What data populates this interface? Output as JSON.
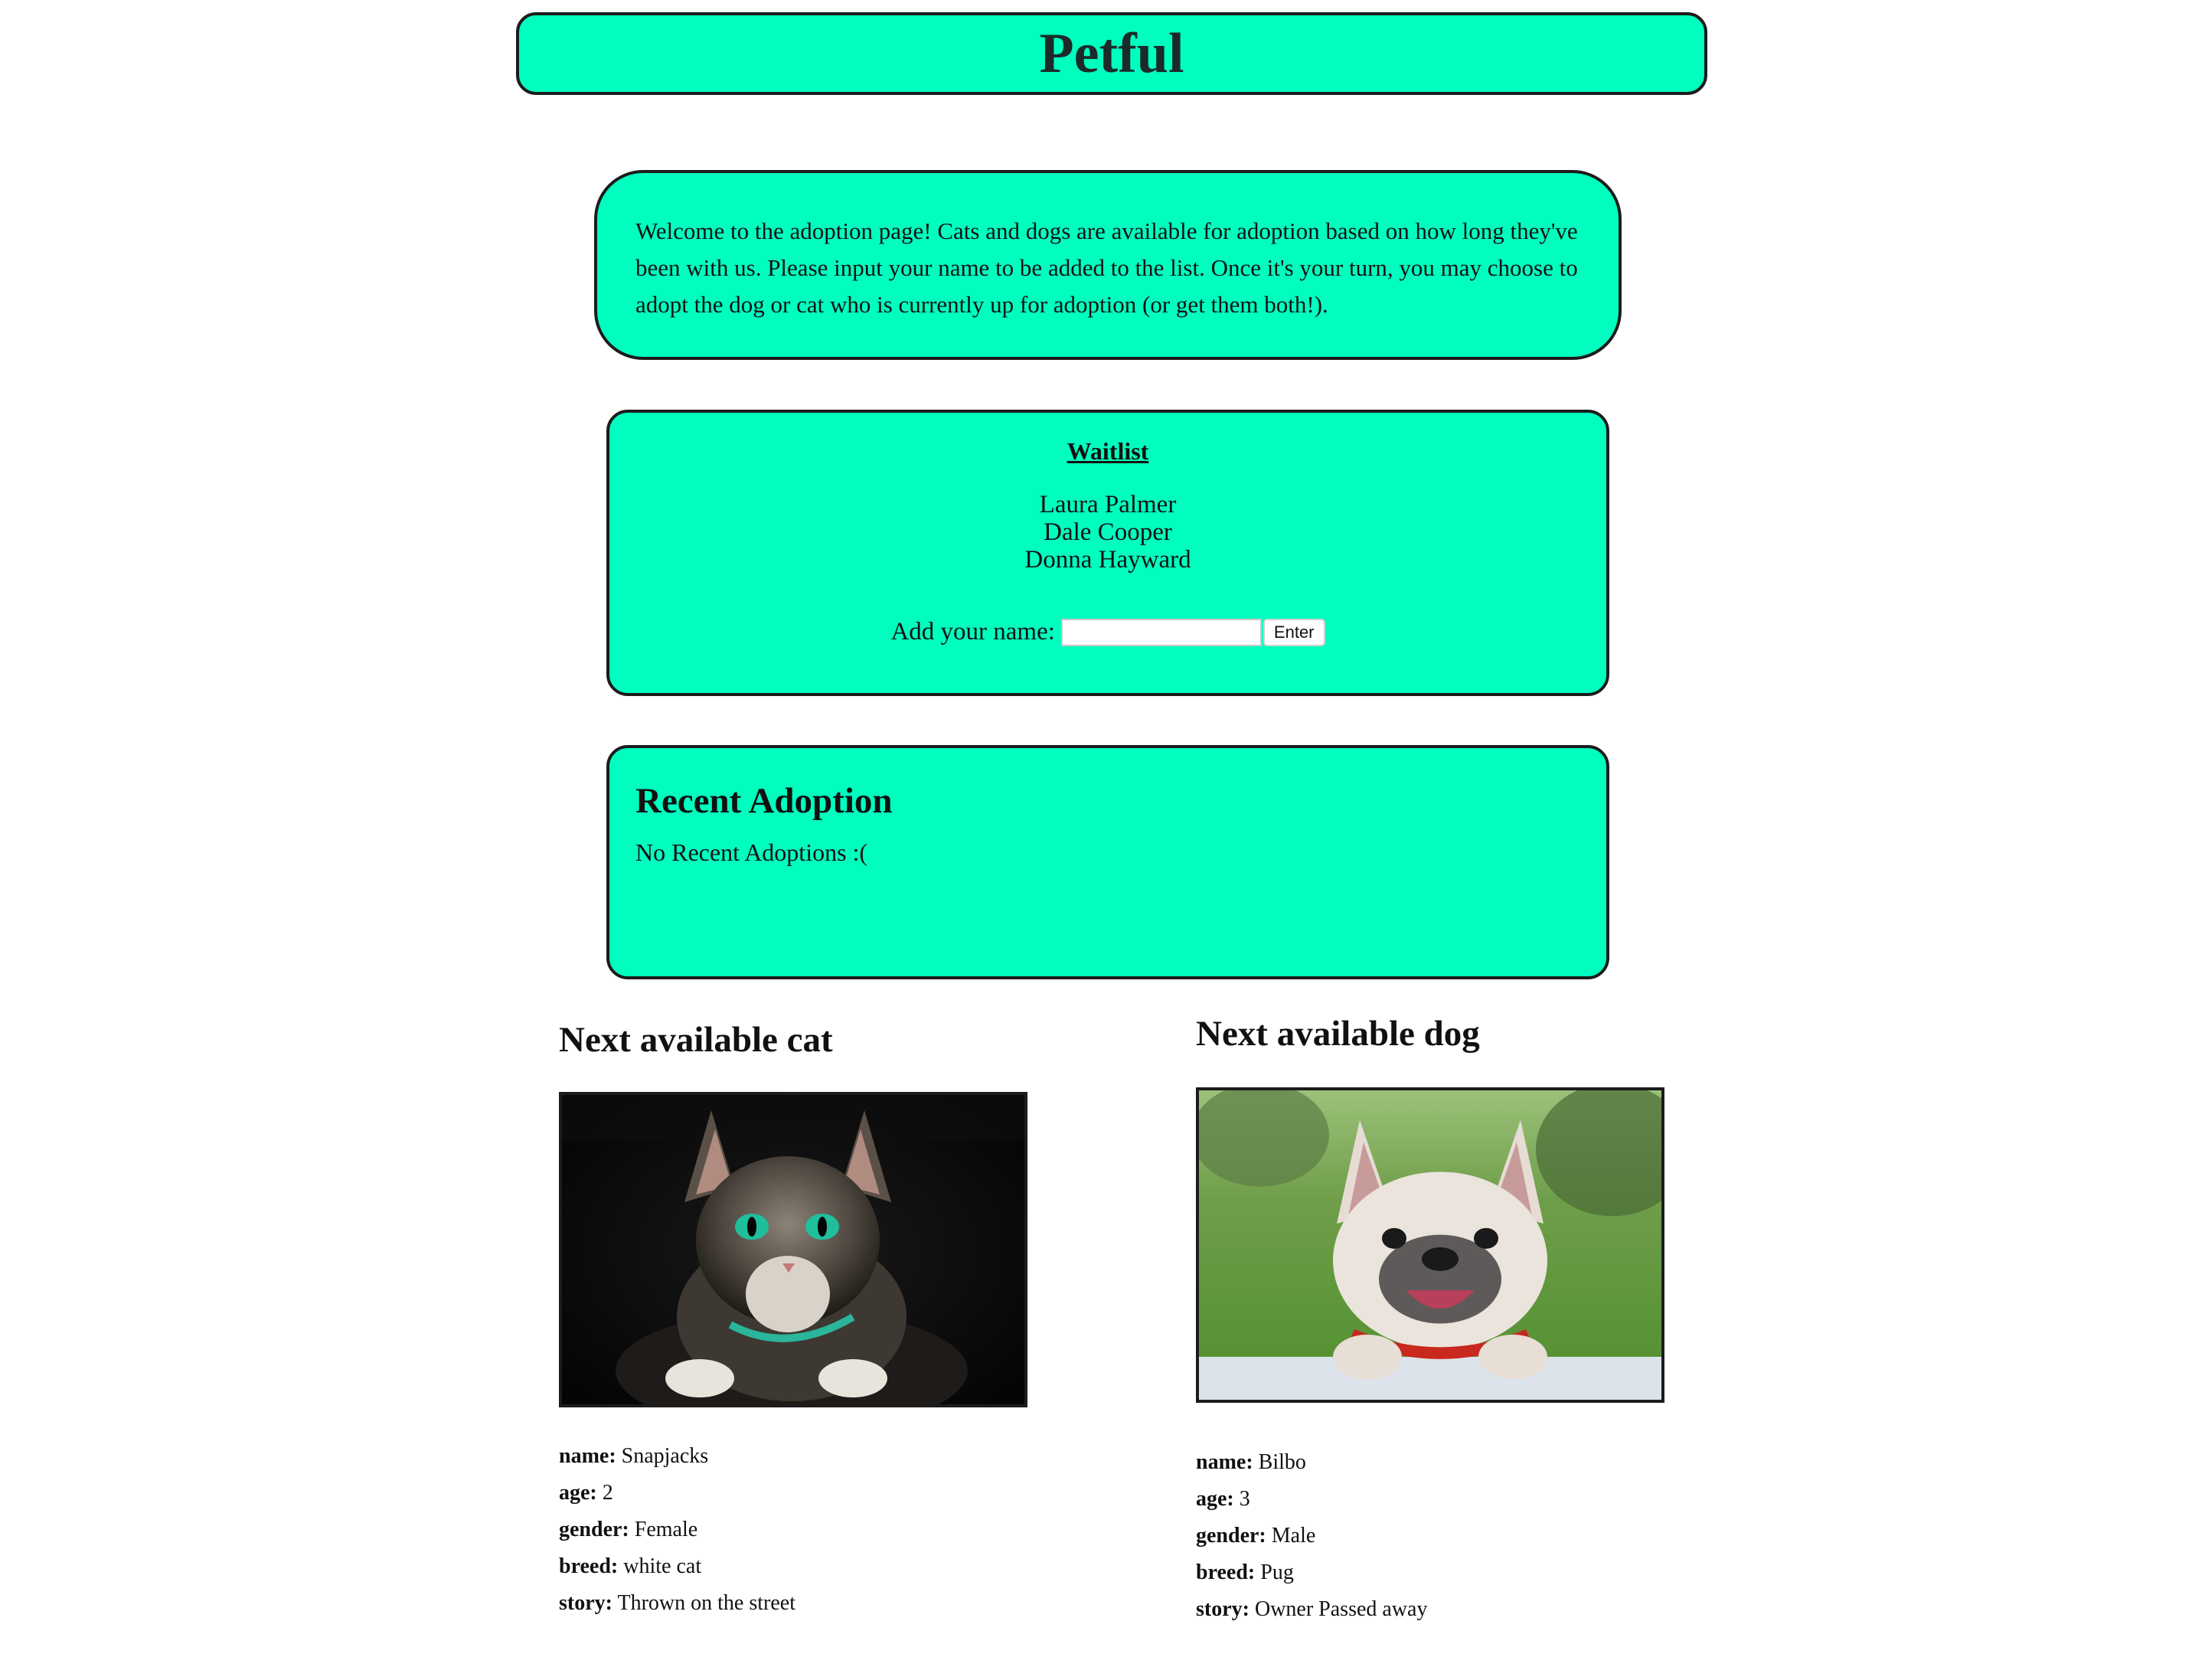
{
  "header": {
    "title": "Petful"
  },
  "intro": {
    "text": "Welcome to the adoption page! Cats and dogs are available for adoption based on how long they've been with us. Please input your name to be added to the list. Once it's your turn, you may choose to adopt the dog or cat who is currently up for adoption (or get them both!)."
  },
  "waitlist": {
    "title": "Waitlist",
    "names": [
      "Laura Palmer",
      "Dale Cooper",
      "Donna Hayward"
    ],
    "add_label": "Add your name:",
    "input_value": "",
    "input_placeholder": "",
    "submit_label": "Enter"
  },
  "recent": {
    "title": "Recent Adoption",
    "message": "No Recent Adoptions :("
  },
  "cat": {
    "heading": "Next available cat",
    "fields": {
      "name": {
        "label": "name:",
        "value": "Snapjacks"
      },
      "age": {
        "label": "age:",
        "value": "2"
      },
      "gender": {
        "label": "gender:",
        "value": "Female"
      },
      "breed": {
        "label": "breed:",
        "value": "white cat"
      },
      "story": {
        "label": "story:",
        "value": "Thrown on the street"
      }
    }
  },
  "dog": {
    "heading": "Next available dog",
    "fields": {
      "name": {
        "label": "name:",
        "value": "Bilbo"
      },
      "age": {
        "label": "age:",
        "value": "3"
      },
      "gender": {
        "label": "gender:",
        "value": "Male"
      },
      "breed": {
        "label": "breed:",
        "value": "Pug"
      },
      "story": {
        "label": "story:",
        "value": "Owner Passed away"
      }
    }
  },
  "colors": {
    "panel": "#00ffbf",
    "border": "#1c1c1c"
  }
}
